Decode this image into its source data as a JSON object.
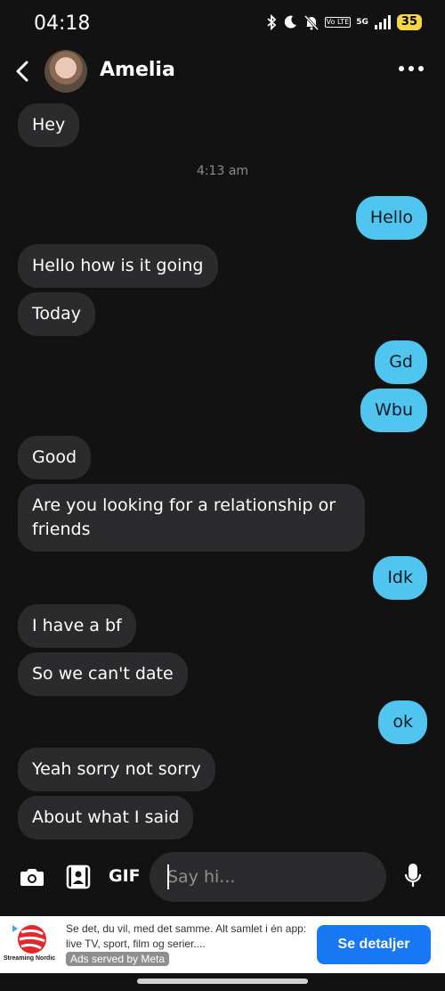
{
  "status_bar": {
    "time": "04:18",
    "network_badge": "Vo LTE",
    "network_type": "5G",
    "battery": "35",
    "icons": [
      "bluetooth-icon",
      "moon-icon",
      "bell-off-icon",
      "signal-icon"
    ]
  },
  "header": {
    "contact_name": "Amelia"
  },
  "conversation": {
    "timestamp": "4:13 am",
    "messages": [
      {
        "dir": "in",
        "text": "Hey"
      },
      {
        "dir": "out",
        "text": "Hello"
      },
      {
        "dir": "in",
        "text": "Hello how is it going"
      },
      {
        "dir": "in",
        "text": "Today"
      },
      {
        "dir": "out",
        "text": "Gd"
      },
      {
        "dir": "out",
        "text": "Wbu"
      },
      {
        "dir": "in",
        "text": "Good"
      },
      {
        "dir": "in",
        "text": "Are you looking for a relationship or friends"
      },
      {
        "dir": "out",
        "text": "Idk"
      },
      {
        "dir": "in",
        "text": "I have a bf"
      },
      {
        "dir": "in",
        "text": "So we can't date"
      },
      {
        "dir": "out",
        "text": "ok"
      },
      {
        "dir": "in",
        "text": "Yeah sorry not sorry"
      },
      {
        "dir": "in",
        "text": "About what I said"
      }
    ]
  },
  "composer": {
    "gif_label": "GIF",
    "placeholder": "Say hi..."
  },
  "ad": {
    "brand": "Streaming Nordic",
    "text": "Se det, du vil, med det samme. Alt samlet i én app: live TV, sport, film og serier....",
    "meta_label": "Ads served by Meta",
    "cta_label": "Se detaljer"
  },
  "colors": {
    "background": "#121212",
    "incoming_bubble": "#2b2b2d",
    "outgoing_bubble": "#4fc5ef",
    "cta": "#1877f2",
    "battery": "#f2d646"
  }
}
